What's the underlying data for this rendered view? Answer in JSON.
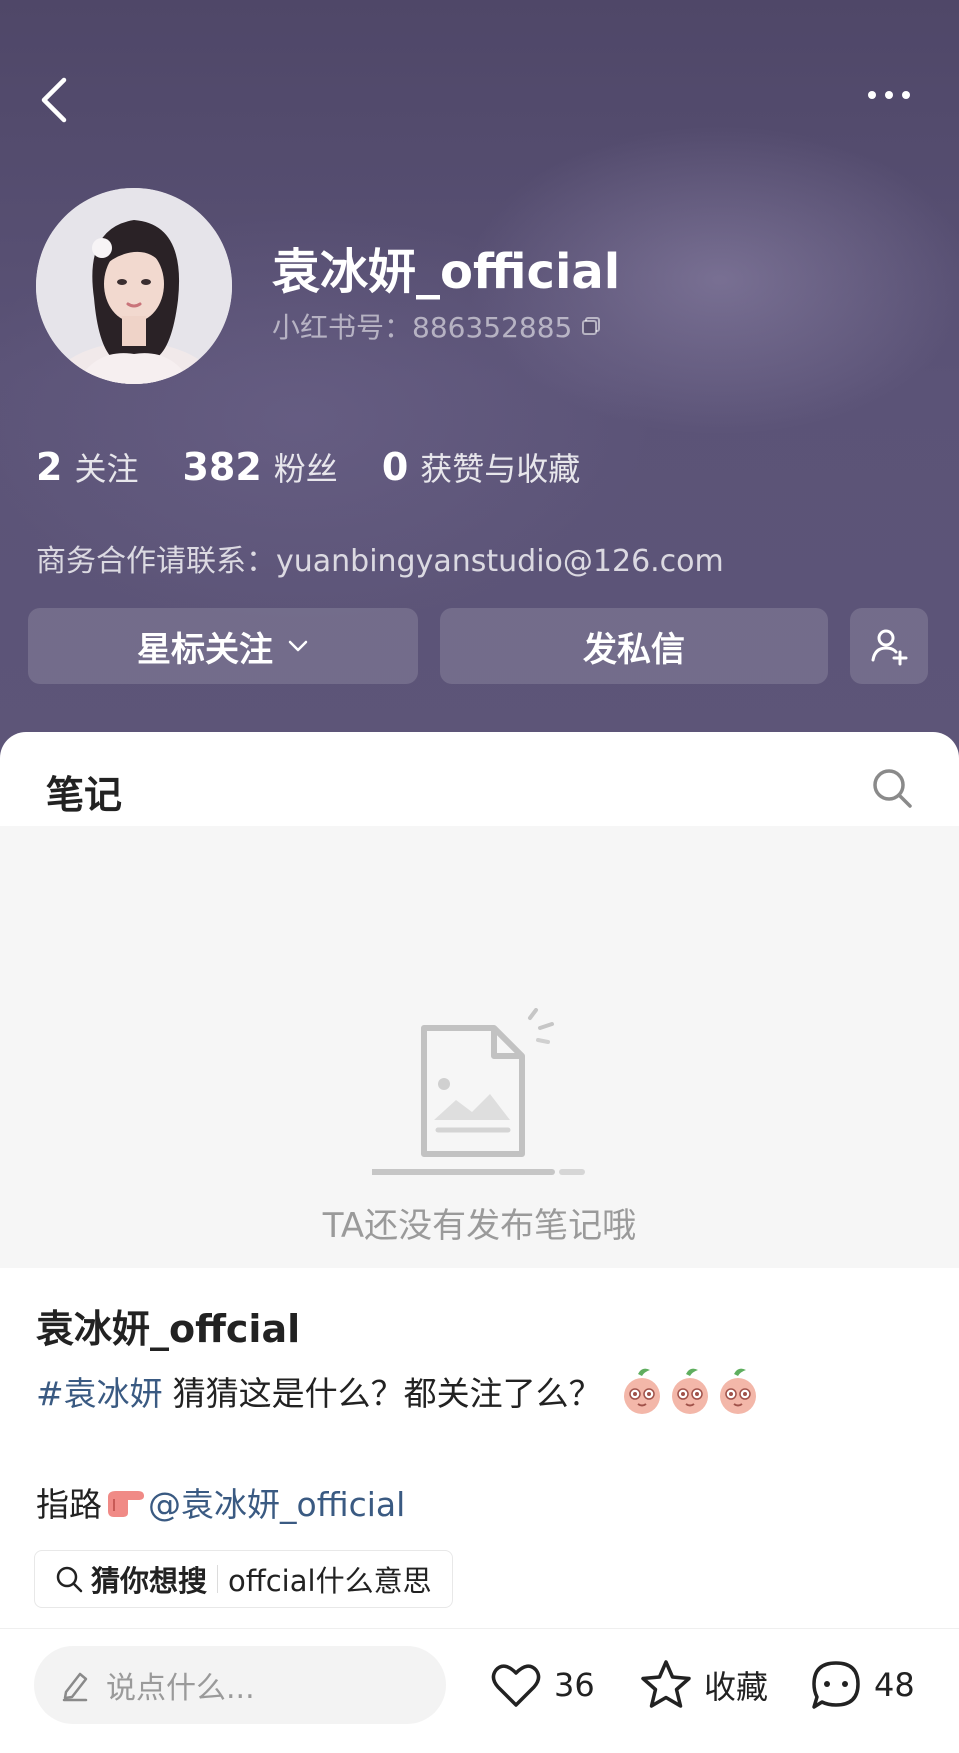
{
  "header": {
    "back_icon": "chevron-left-icon",
    "more_icon": "more-dots-icon"
  },
  "profile": {
    "username": "袁冰妍_official",
    "id_label": "小红书号：886352885",
    "stats": [
      {
        "value": "2",
        "label": "关注"
      },
      {
        "value": "382",
        "label": "粉丝"
      },
      {
        "value": "0",
        "label": "获赞与收藏"
      }
    ],
    "contact": "商务合作请联系：yuanbingyanstudio@126.com"
  },
  "actions": {
    "follow_label": "星标关注",
    "message_label": "发私信"
  },
  "tabs": {
    "notes_label": "笔记"
  },
  "empty": {
    "text": "TA还没有发布笔记哦"
  },
  "post": {
    "author": "袁冰妍_offcial",
    "hashtag": "#袁冰妍",
    "line1_text": "猜猜这是什么？都关注了么？",
    "line2_prefix": "指路",
    "mention": "@袁冰妍_official",
    "suggest_label": "猜你想搜",
    "suggest_query": "offcial什么意思"
  },
  "bottom_bar": {
    "comment_placeholder": "说点什么...",
    "likes": "36",
    "favorite_label": "收藏",
    "comments": "48"
  },
  "colors": {
    "hero_bg": "#5b5377",
    "link": "#3a5a82"
  }
}
